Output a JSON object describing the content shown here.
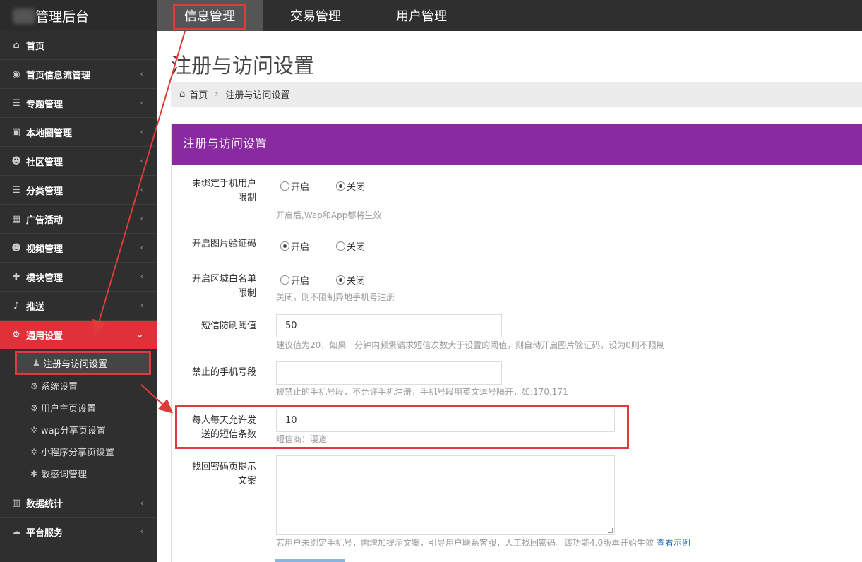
{
  "brand": {
    "title": "管理后台"
  },
  "top_nav": [
    {
      "label": "信息管理",
      "active": true
    },
    {
      "label": "交易管理"
    },
    {
      "label": "用户管理"
    }
  ],
  "sidebar": {
    "items": [
      {
        "label": "首页",
        "icon": "home-icon"
      },
      {
        "label": "首页信息流管理",
        "icon": "rss-icon"
      },
      {
        "label": "专题管理",
        "icon": "list-icon"
      },
      {
        "label": "本地圈管理",
        "icon": "camera-icon"
      },
      {
        "label": "社区管理",
        "icon": "users-icon"
      },
      {
        "label": "分类管理",
        "icon": "list-icon"
      },
      {
        "label": "广告活动",
        "icon": "calendar-icon"
      },
      {
        "label": "视频管理",
        "icon": "users-icon"
      },
      {
        "label": "模块管理",
        "icon": "puzzle-icon"
      },
      {
        "label": "推送",
        "icon": "bell-icon"
      },
      {
        "label": "通用设置",
        "icon": "cogs-icon",
        "active": true
      }
    ],
    "submenu": [
      {
        "label": "注册与访问设置",
        "icon": "user-icon",
        "active": true
      },
      {
        "label": "系统设置",
        "icon": "cogs-icon"
      },
      {
        "label": "用户主页设置",
        "icon": "cogs-icon"
      },
      {
        "label": "wap分享页设置",
        "icon": "gear-icon"
      },
      {
        "label": "小程序分享页设置",
        "icon": "gear-icon"
      },
      {
        "label": "敏感词管理",
        "icon": "asterisk-icon"
      }
    ],
    "bottom_items": [
      {
        "label": "数据统计",
        "icon": "bar-chart-icon"
      },
      {
        "label": "平台服务",
        "icon": "cloud-icon"
      }
    ]
  },
  "page": {
    "title": "注册与访问设置",
    "breadcrumb": {
      "home": "首页",
      "separator": "›",
      "current": "注册与访问设置"
    },
    "panel_title": "注册与访问设置"
  },
  "form": {
    "unbound_phone": {
      "label_line1": "未绑定手机用户",
      "label_line2": "限制",
      "opt_on": "开启",
      "opt_off": "关闭",
      "selected": "关闭",
      "help": "开启后,Wap和App都将生效"
    },
    "image_captcha": {
      "label": "开启图片验证码",
      "opt_on": "开启",
      "opt_off": "关闭",
      "selected": "开启"
    },
    "region_whitelist": {
      "label_line1": "开启区域白名单",
      "label_line2": "限制",
      "opt_on": "开启",
      "opt_off": "关闭",
      "selected": "关闭",
      "help": "关闭，则不限制异地手机号注册"
    },
    "sms_threshold": {
      "label": "短信防刷阈值",
      "value": "50",
      "help": "建议值为20，如果一分钟内频繁请求短信次数大于设置的阈值，则自动开启图片验证码，设为0则不限制"
    },
    "banned_prefixes": {
      "label": "禁止的手机号段",
      "value": "",
      "help": "被禁止的手机号段，不允许手机注册，手机号段用英文逗号隔开，如:170,171"
    },
    "daily_sms_limit": {
      "label_line1": "每人每天允许发",
      "label_line2": "送的短信条数",
      "value": "10",
      "help": "短信商：漫道"
    },
    "recover_password_text": {
      "label_line1": "找回密码页提示",
      "label_line2": "文案",
      "value": "",
      "help": "若用户未绑定手机号，需增加提示文案，引导用户联系客服，人工找回密码。该功能4.0版本开始生效",
      "help_link": "查看示例"
    }
  },
  "colors": {
    "accent_red": "#e0303a",
    "panel_purple": "#8a2aa0",
    "sidebar_bg": "#2f2f2f",
    "annotation_red": "#e03b3b"
  }
}
